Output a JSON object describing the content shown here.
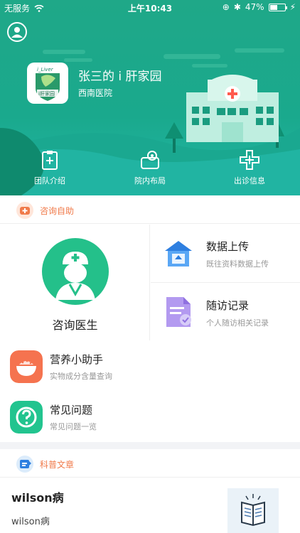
{
  "status_bar": {
    "carrier": "无服务",
    "time": "上午10:43",
    "battery": "47%",
    "battery_level": 0.47
  },
  "hero": {
    "title": "张三的 i 肝家园",
    "hospital": "西南医院",
    "logo_text": "i_Liver",
    "logo_cn": "i肝家园"
  },
  "quick_actions": [
    {
      "label": "团队介绍",
      "icon": "clipboard-plus-icon"
    },
    {
      "label": "院内布局",
      "icon": "map-pin-icon"
    },
    {
      "label": "出诊信息",
      "icon": "medical-cross-icon"
    }
  ],
  "consult_section": {
    "label": "咨询自助",
    "doctor": {
      "label": "咨询医生"
    },
    "upload": {
      "title": "数据上传",
      "sub": "既往资料数据上传"
    },
    "followup": {
      "title": "随访记录",
      "sub": "个人随访相关记录"
    }
  },
  "rows": [
    {
      "title": "营养小助手",
      "sub": "实物成分含量查询",
      "icon": "food-bowl-icon",
      "color": "#f5734f"
    },
    {
      "title": "常见问题",
      "sub": "常见问题一览",
      "icon": "question-icon",
      "color": "#22c48f"
    }
  ],
  "science_section": {
    "label": "科普文章"
  },
  "article": {
    "title": "wilson病",
    "sub": "wilson病"
  },
  "colors": {
    "primary": "#1fa888",
    "accent": "#f07a4a"
  }
}
